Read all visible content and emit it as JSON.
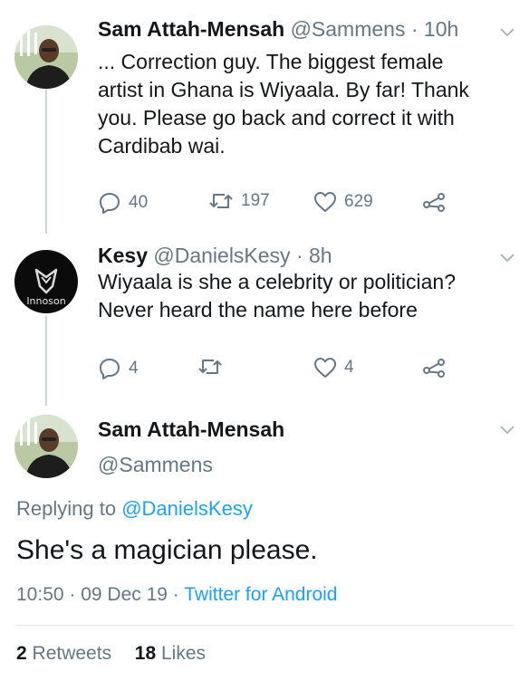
{
  "tweets": [
    {
      "name": "Sam Attah-Mensah",
      "handle": "@Sammens",
      "time": "10h",
      "text_lines": [
        "... Correction guy. The biggest female",
        "artist in Ghana is Wiyaala. By far! Thank",
        "you. Please go back and correct it with",
        "Cardibab wai."
      ],
      "replies": "40",
      "retweets": "197",
      "likes": "629"
    },
    {
      "name": "Kesy",
      "handle": "@DanielsKesy",
      "time": "8h",
      "text_lines": [
        "Wiyaala is she a celebrity or politician?",
        "Never heard the name here before"
      ],
      "avatar_text": "Innoson",
      "replies": "4",
      "retweets": "",
      "likes": "4"
    }
  ],
  "main_tweet": {
    "name": "Sam Attah-Mensah",
    "handle": "@Sammens",
    "replying_prefix": "Replying to",
    "replying_to": "@DanielsKesy",
    "text": "She's a magician please.",
    "timestamp": "10:50 · 09 Dec 19 ·",
    "source": "Twitter for Android",
    "retweets_count": "2",
    "retweets_label": "Retweets",
    "likes_count": "18",
    "likes_label": "Likes"
  },
  "colors": {
    "link": "#1da1f2",
    "muted": "#657786",
    "text": "#14171a",
    "thread_line": "#ccd6dd"
  },
  "icons": [
    "reply-icon",
    "retweet-icon",
    "like-icon",
    "share-icon",
    "chevron-down-icon"
  ]
}
